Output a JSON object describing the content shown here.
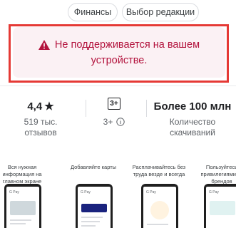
{
  "chips": [
    "Финансы",
    "Выбор редакции"
  ],
  "warning": {
    "line1": "Не поддерживается на вашем",
    "line2": "устройстве."
  },
  "stats": {
    "rating": "4,4",
    "reviews": "519 тыс. отзывов",
    "age_badge": "3+",
    "age_label": "3+",
    "installs": "Более 100 млн",
    "installs_label_1": "Количество",
    "installs_label_2": "скачиваний"
  },
  "screenshots": [
    {
      "caption": "Вся нужная информация на главном экране"
    },
    {
      "caption": "Добавляйте карты"
    },
    {
      "caption": "Расплачивайтесь без труда везде и всегда"
    },
    {
      "caption": "Пользуйтесь привилегиями от брендов"
    }
  ],
  "gpay_label": "G Pay"
}
